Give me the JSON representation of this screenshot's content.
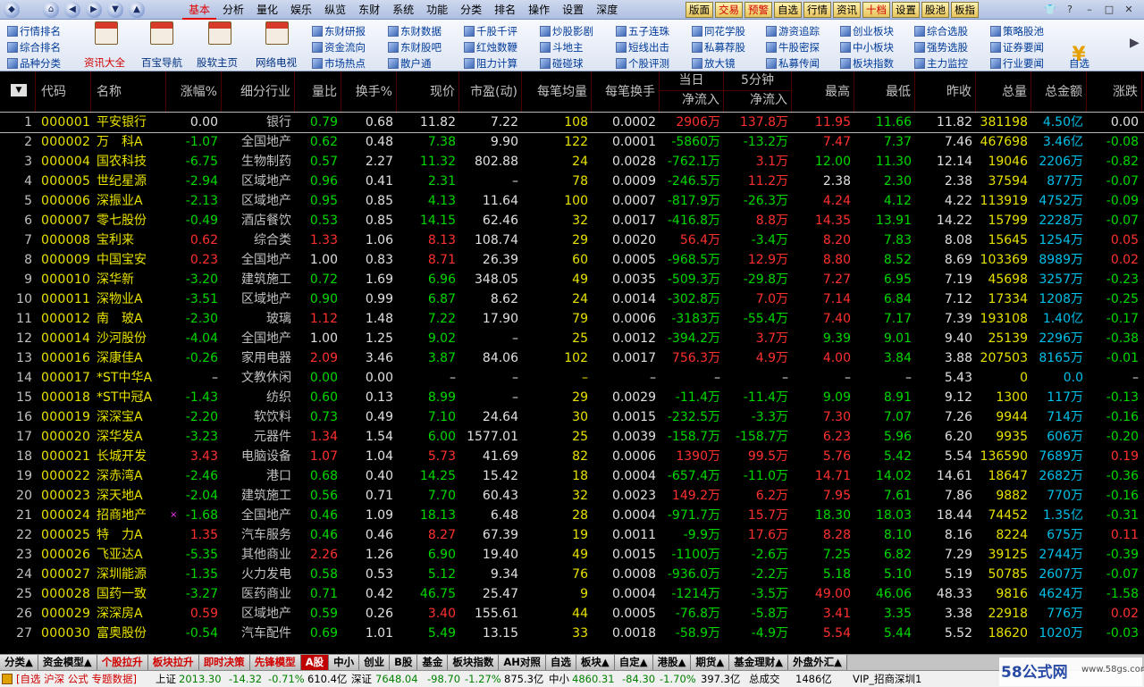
{
  "menu": {
    "items": [
      "基本",
      "分析",
      "量化",
      "娱乐",
      "纵览",
      "东财",
      "系统",
      "功能",
      "分类",
      "排名",
      "操作",
      "设置",
      "深度"
    ],
    "active": 0
  },
  "title_tabs": [
    "版面",
    "交易",
    "预警",
    "自选",
    "行情",
    "资讯",
    "十档",
    "设置",
    "股池",
    "板指"
  ],
  "toolbar": {
    "left_links": [
      "行情排名",
      "综合排名",
      "品种分类"
    ],
    "big_buttons": [
      "资讯大全",
      "百宝导航",
      "股软主页",
      "网络电视"
    ],
    "link_grid": [
      [
        "东财研报",
        "东财数据",
        "千股千评",
        "炒股影剧",
        "五子连珠",
        "同花学股",
        "游资追踪",
        "创业板块",
        "综合选股",
        "策略股池"
      ],
      [
        "资金流向",
        "东财股吧",
        "红烛数鞭",
        "斗地主",
        "短线出击",
        "私募荐股",
        "牛股密探",
        "中小板块",
        "强势选股",
        "证券要闻"
      ],
      [
        "市场热点",
        "散户通",
        "阻力计算",
        "碰碰球",
        "个股评测",
        "放大镜",
        "私募传闻",
        "板块指数",
        "主力监控",
        "行业要闻"
      ]
    ],
    "right_label": "自选"
  },
  "table": {
    "headers": {
      "code": "代码",
      "name": "名称",
      "chg": "涨幅%",
      "ind": "细分行业",
      "vr": "量比",
      "turn": "换手%",
      "price": "现价",
      "pe": "市盈(动)",
      "avg": "每笔均量",
      "ato": "每笔换手",
      "day_top": "当日",
      "day_bot": "净流入",
      "m5_top": "5分钟",
      "m5_bot": "净流入",
      "high": "最高",
      "low": "最低",
      "prev": "昨收",
      "vol": "总量",
      "amt": "总金额",
      "up": "涨跌"
    },
    "rows": [
      {
        "i": "1",
        "code": "000001",
        "name": "平安银行",
        "chg": "0.00",
        "ind": "银行",
        "vr": "0.79",
        "turn": "0.68",
        "price": "11.82",
        "pe": "7.22",
        "avg": "108",
        "ato": "0.0002",
        "day": "2906万",
        "m5": "137.8万",
        "high": "11.95",
        "low": "11.66",
        "prev": "11.82",
        "vol": "381198",
        "amt": "4.50亿",
        "up": "0.00"
      },
      {
        "i": "2",
        "code": "000002",
        "name": "万　科A",
        "chg": "-1.07",
        "ind": "全国地产",
        "vr": "0.62",
        "turn": "0.48",
        "price": "7.38",
        "pe": "9.90",
        "avg": "122",
        "ato": "0.0001",
        "day": "-5860万",
        "m5": "-13.2万",
        "high": "7.47",
        "low": "7.37",
        "prev": "7.46",
        "vol": "467698",
        "amt": "3.46亿",
        "up": "-0.08"
      },
      {
        "i": "3",
        "code": "000004",
        "name": "国农科技",
        "chg": "-6.75",
        "ind": "生物制药",
        "vr": "0.57",
        "turn": "2.27",
        "price": "11.32",
        "pe": "802.88",
        "avg": "24",
        "ato": "0.0028",
        "day": "-762.1万",
        "m5": "3.1万",
        "high": "12.00",
        "low": "11.30",
        "prev": "12.14",
        "vol": "19046",
        "amt": "2206万",
        "up": "-0.82"
      },
      {
        "i": "4",
        "code": "000005",
        "name": "世纪星源",
        "chg": "-2.94",
        "ind": "区域地产",
        "vr": "0.96",
        "turn": "0.41",
        "price": "2.31",
        "pe": "–",
        "avg": "78",
        "ato": "0.0009",
        "day": "-246.5万",
        "m5": "11.2万",
        "high": "2.38",
        "low": "2.30",
        "prev": "2.38",
        "vol": "37594",
        "amt": "877万",
        "up": "-0.07"
      },
      {
        "i": "5",
        "code": "000006",
        "name": "深振业A",
        "chg": "-2.13",
        "ind": "区域地产",
        "vr": "0.95",
        "turn": "0.85",
        "price": "4.13",
        "pe": "11.64",
        "avg": "100",
        "ato": "0.0007",
        "day": "-817.9万",
        "m5": "-26.3万",
        "high": "4.24",
        "low": "4.12",
        "prev": "4.22",
        "vol": "113919",
        "amt": "4752万",
        "up": "-0.09"
      },
      {
        "i": "6",
        "code": "000007",
        "name": "零七股份",
        "chg": "-0.49",
        "ind": "酒店餐饮",
        "vr": "0.53",
        "turn": "0.85",
        "price": "14.15",
        "pe": "62.46",
        "avg": "32",
        "ato": "0.0017",
        "day": "-416.8万",
        "m5": "8.8万",
        "high": "14.35",
        "low": "13.91",
        "prev": "14.22",
        "vol": "15799",
        "amt": "2228万",
        "up": "-0.07"
      },
      {
        "i": "7",
        "code": "000008",
        "name": "宝利来",
        "chg": "0.62",
        "ind": "综合类",
        "vr": "1.33",
        "turn": "1.06",
        "price": "8.13",
        "pe": "108.74",
        "avg": "29",
        "ato": "0.0020",
        "day": "56.4万",
        "m5": "-3.4万",
        "high": "8.20",
        "low": "7.83",
        "prev": "8.08",
        "vol": "15645",
        "amt": "1254万",
        "up": "0.05"
      },
      {
        "i": "8",
        "code": "000009",
        "name": "中国宝安",
        "chg": "0.23",
        "ind": "全国地产",
        "vr": "1.00",
        "turn": "0.83",
        "price": "8.71",
        "pe": "26.39",
        "avg": "60",
        "ato": "0.0005",
        "day": "-968.5万",
        "m5": "12.9万",
        "high": "8.80",
        "low": "8.52",
        "prev": "8.69",
        "vol": "103369",
        "amt": "8989万",
        "up": "0.02"
      },
      {
        "i": "9",
        "code": "000010",
        "name": "深华新",
        "chg": "-3.20",
        "ind": "建筑施工",
        "vr": "0.72",
        "turn": "1.69",
        "price": "6.96",
        "pe": "348.05",
        "avg": "49",
        "ato": "0.0035",
        "day": "-509.3万",
        "m5": "-29.8万",
        "high": "7.27",
        "low": "6.95",
        "prev": "7.19",
        "vol": "45698",
        "amt": "3257万",
        "up": "-0.23"
      },
      {
        "i": "10",
        "code": "000011",
        "name": "深物业A",
        "chg": "-3.51",
        "ind": "区域地产",
        "vr": "0.90",
        "turn": "0.99",
        "price": "6.87",
        "pe": "8.62",
        "avg": "24",
        "ato": "0.0014",
        "day": "-302.8万",
        "m5": "7.0万",
        "high": "7.14",
        "low": "6.84",
        "prev": "7.12",
        "vol": "17334",
        "amt": "1208万",
        "up": "-0.25"
      },
      {
        "i": "11",
        "code": "000012",
        "name": "南　玻A",
        "chg": "-2.30",
        "ind": "玻璃",
        "vr": "1.12",
        "turn": "1.48",
        "price": "7.22",
        "pe": "17.90",
        "avg": "79",
        "ato": "0.0006",
        "day": "-3183万",
        "m5": "-55.4万",
        "high": "7.40",
        "low": "7.17",
        "prev": "7.39",
        "vol": "193108",
        "amt": "1.40亿",
        "up": "-0.17"
      },
      {
        "i": "12",
        "code": "000014",
        "name": "沙河股份",
        "chg": "-4.04",
        "ind": "全国地产",
        "vr": "1.00",
        "turn": "1.25",
        "price": "9.02",
        "pe": "–",
        "avg": "25",
        "ato": "0.0012",
        "day": "-394.2万",
        "m5": "3.7万",
        "high": "9.39",
        "low": "9.01",
        "prev": "9.40",
        "vol": "25139",
        "amt": "2296万",
        "up": "-0.38"
      },
      {
        "i": "13",
        "code": "000016",
        "name": "深康佳A",
        "chg": "-0.26",
        "ind": "家用电器",
        "vr": "2.09",
        "turn": "3.46",
        "price": "3.87",
        "pe": "84.06",
        "avg": "102",
        "ato": "0.0017",
        "day": "756.3万",
        "m5": "4.9万",
        "high": "4.00",
        "low": "3.84",
        "prev": "3.88",
        "vol": "207503",
        "amt": "8165万",
        "up": "-0.01"
      },
      {
        "i": "14",
        "code": "000017",
        "name": "*ST中华A",
        "chg": "–",
        "ind": "文教休闲",
        "vr": "0.00",
        "turn": "0.00",
        "price": "–",
        "pe": "–",
        "avg": "–",
        "ato": "–",
        "day": "–",
        "m5": "–",
        "high": "–",
        "low": "–",
        "prev": "5.43",
        "vol": "0",
        "amt": "0.0",
        "up": "–"
      },
      {
        "i": "15",
        "code": "000018",
        "name": "*ST中冠A",
        "chg": "-1.43",
        "ind": "纺织",
        "vr": "0.60",
        "turn": "0.13",
        "price": "8.99",
        "pe": "–",
        "avg": "29",
        "ato": "0.0029",
        "day": "-11.4万",
        "m5": "-11.4万",
        "high": "9.09",
        "low": "8.91",
        "prev": "9.12",
        "vol": "1300",
        "amt": "117万",
        "up": "-0.13"
      },
      {
        "i": "16",
        "code": "000019",
        "name": "深深宝A",
        "chg": "-2.20",
        "ind": "软饮料",
        "vr": "0.73",
        "turn": "0.49",
        "price": "7.10",
        "pe": "24.64",
        "avg": "30",
        "ato": "0.0015",
        "day": "-232.5万",
        "m5": "-3.3万",
        "high": "7.30",
        "low": "7.07",
        "prev": "7.26",
        "vol": "9944",
        "amt": "714万",
        "up": "-0.16"
      },
      {
        "i": "17",
        "code": "000020",
        "name": "深华发A",
        "chg": "-3.23",
        "ind": "元器件",
        "vr": "1.34",
        "turn": "1.54",
        "price": "6.00",
        "pe": "1577.01",
        "avg": "25",
        "ato": "0.0039",
        "day": "-158.7万",
        "m5": "-158.7万",
        "high": "6.23",
        "low": "5.96",
        "prev": "6.20",
        "vol": "9935",
        "amt": "606万",
        "up": "-0.20"
      },
      {
        "i": "18",
        "code": "000021",
        "name": "长城开发",
        "chg": "3.43",
        "ind": "电脑设备",
        "vr": "1.07",
        "turn": "1.04",
        "price": "5.73",
        "pe": "41.69",
        "avg": "82",
        "ato": "0.0006",
        "day": "1390万",
        "m5": "99.5万",
        "high": "5.76",
        "low": "5.42",
        "prev": "5.54",
        "vol": "136590",
        "amt": "7689万",
        "up": "0.19"
      },
      {
        "i": "19",
        "code": "000022",
        "name": "深赤湾A",
        "chg": "-2.46",
        "ind": "港口",
        "vr": "0.68",
        "turn": "0.40",
        "price": "14.25",
        "pe": "15.42",
        "avg": "18",
        "ato": "0.0004",
        "day": "-657.4万",
        "m5": "-11.0万",
        "high": "14.71",
        "low": "14.02",
        "prev": "14.61",
        "vol": "18647",
        "amt": "2682万",
        "up": "-0.36"
      },
      {
        "i": "20",
        "code": "000023",
        "name": "深天地A",
        "chg": "-2.04",
        "ind": "建筑施工",
        "vr": "0.56",
        "turn": "0.71",
        "price": "7.70",
        "pe": "60.43",
        "avg": "32",
        "ato": "0.0023",
        "day": "149.2万",
        "m5": "6.2万",
        "high": "7.95",
        "low": "7.61",
        "prev": "7.86",
        "vol": "9882",
        "amt": "770万",
        "up": "-0.16"
      },
      {
        "i": "21",
        "code": "000024",
        "name": "招商地产",
        "chg": "-1.68",
        "ind": "全国地产",
        "vr": "0.46",
        "turn": "1.09",
        "price": "18.13",
        "pe": "6.48",
        "avg": "28",
        "ato": "0.0004",
        "day": "-971.7万",
        "m5": "15.7万",
        "high": "18.30",
        "low": "18.03",
        "prev": "18.44",
        "vol": "74452",
        "amt": "1.35亿",
        "up": "-0.31"
      },
      {
        "i": "22",
        "code": "000025",
        "name": "特　力A",
        "chg": "1.35",
        "ind": "汽车服务",
        "vr": "0.46",
        "turn": "0.46",
        "price": "8.27",
        "pe": "67.39",
        "avg": "19",
        "ato": "0.0011",
        "day": "-9.9万",
        "m5": "17.6万",
        "high": "8.28",
        "low": "8.10",
        "prev": "8.16",
        "vol": "8224",
        "amt": "675万",
        "up": "0.11"
      },
      {
        "i": "23",
        "code": "000026",
        "name": "飞亚达A",
        "chg": "-5.35",
        "ind": "其他商业",
        "vr": "2.26",
        "turn": "1.26",
        "price": "6.90",
        "pe": "19.40",
        "avg": "49",
        "ato": "0.0015",
        "day": "-1100万",
        "m5": "-2.6万",
        "high": "7.25",
        "low": "6.82",
        "prev": "7.29",
        "vol": "39125",
        "amt": "2744万",
        "up": "-0.39"
      },
      {
        "i": "24",
        "code": "000027",
        "name": "深圳能源",
        "chg": "-1.35",
        "ind": "火力发电",
        "vr": "0.58",
        "turn": "0.53",
        "price": "5.12",
        "pe": "9.34",
        "avg": "76",
        "ato": "0.0008",
        "day": "-936.0万",
        "m5": "-2.2万",
        "high": "5.18",
        "low": "5.10",
        "prev": "5.19",
        "vol": "50785",
        "amt": "2607万",
        "up": "-0.07"
      },
      {
        "i": "25",
        "code": "000028",
        "name": "国药一致",
        "chg": "-3.27",
        "ind": "医药商业",
        "vr": "0.71",
        "turn": "0.42",
        "price": "46.75",
        "pe": "25.47",
        "avg": "9",
        "ato": "0.0004",
        "day": "-1214万",
        "m5": "-3.5万",
        "high": "49.00",
        "low": "46.06",
        "prev": "48.33",
        "vol": "9816",
        "amt": "4624万",
        "up": "-1.58"
      },
      {
        "i": "26",
        "code": "000029",
        "name": "深深房A",
        "chg": "0.59",
        "ind": "区域地产",
        "vr": "0.59",
        "turn": "0.26",
        "price": "3.40",
        "pe": "155.61",
        "avg": "44",
        "ato": "0.0005",
        "day": "-76.8万",
        "m5": "-5.8万",
        "high": "3.41",
        "low": "3.35",
        "prev": "3.38",
        "vol": "22918",
        "amt": "776万",
        "up": "0.02"
      },
      {
        "i": "27",
        "code": "000030",
        "name": "富奥股份",
        "chg": "-0.54",
        "ind": "汽车配件",
        "vr": "0.69",
        "turn": "1.01",
        "price": "5.49",
        "pe": "13.15",
        "avg": "33",
        "ato": "0.0018",
        "day": "-58.9万",
        "m5": "-4.9万",
        "high": "5.54",
        "low": "5.44",
        "prev": "5.52",
        "vol": "18620",
        "amt": "1020万",
        "up": "-0.03"
      }
    ]
  },
  "bottom_tabs": [
    "分类▲",
    "资金模型▲",
    "个股拉升",
    "板块拉升",
    "即时决策",
    "先锋模型",
    "A股",
    "中小",
    "创业",
    "B股",
    "基金",
    "板块指数",
    "AH对照",
    "自选",
    "板块▲",
    "自定▲",
    "港股▲",
    "期货▲",
    "基金理财▲",
    "外盘外汇▲"
  ],
  "status": {
    "prefix": "[自选 沪深 公式 专题数据]",
    "sh_label": "上证",
    "sh_val": "2013.30",
    "sh_chg": "-14.32",
    "sh_pct": "-0.71%",
    "sh_amt": "610.4亿",
    "sz_label": "深证",
    "sz_val": "7648.04",
    "sz_chg": "-98.70",
    "sz_pct": "-1.27%",
    "sz_amt": "875.3亿",
    "zx_label": "中小",
    "zx_val": "4860.31",
    "zx_chg": "-84.30",
    "zx_pct": "-1.70%",
    "zx_amt": "397.3亿",
    "deal_label": "总成交",
    "deal_val": "1486亿",
    "vip": "VIP_招商深圳1"
  },
  "watermark": {
    "brand": "58公式网",
    "url": "www.58gs.com"
  },
  "colors": {
    "up": "#ff3030",
    "down": "#00d800",
    "code": "#e7e100",
    "amount": "#00c0e8",
    "header": "#c0c0c0",
    "background": "#000000"
  }
}
